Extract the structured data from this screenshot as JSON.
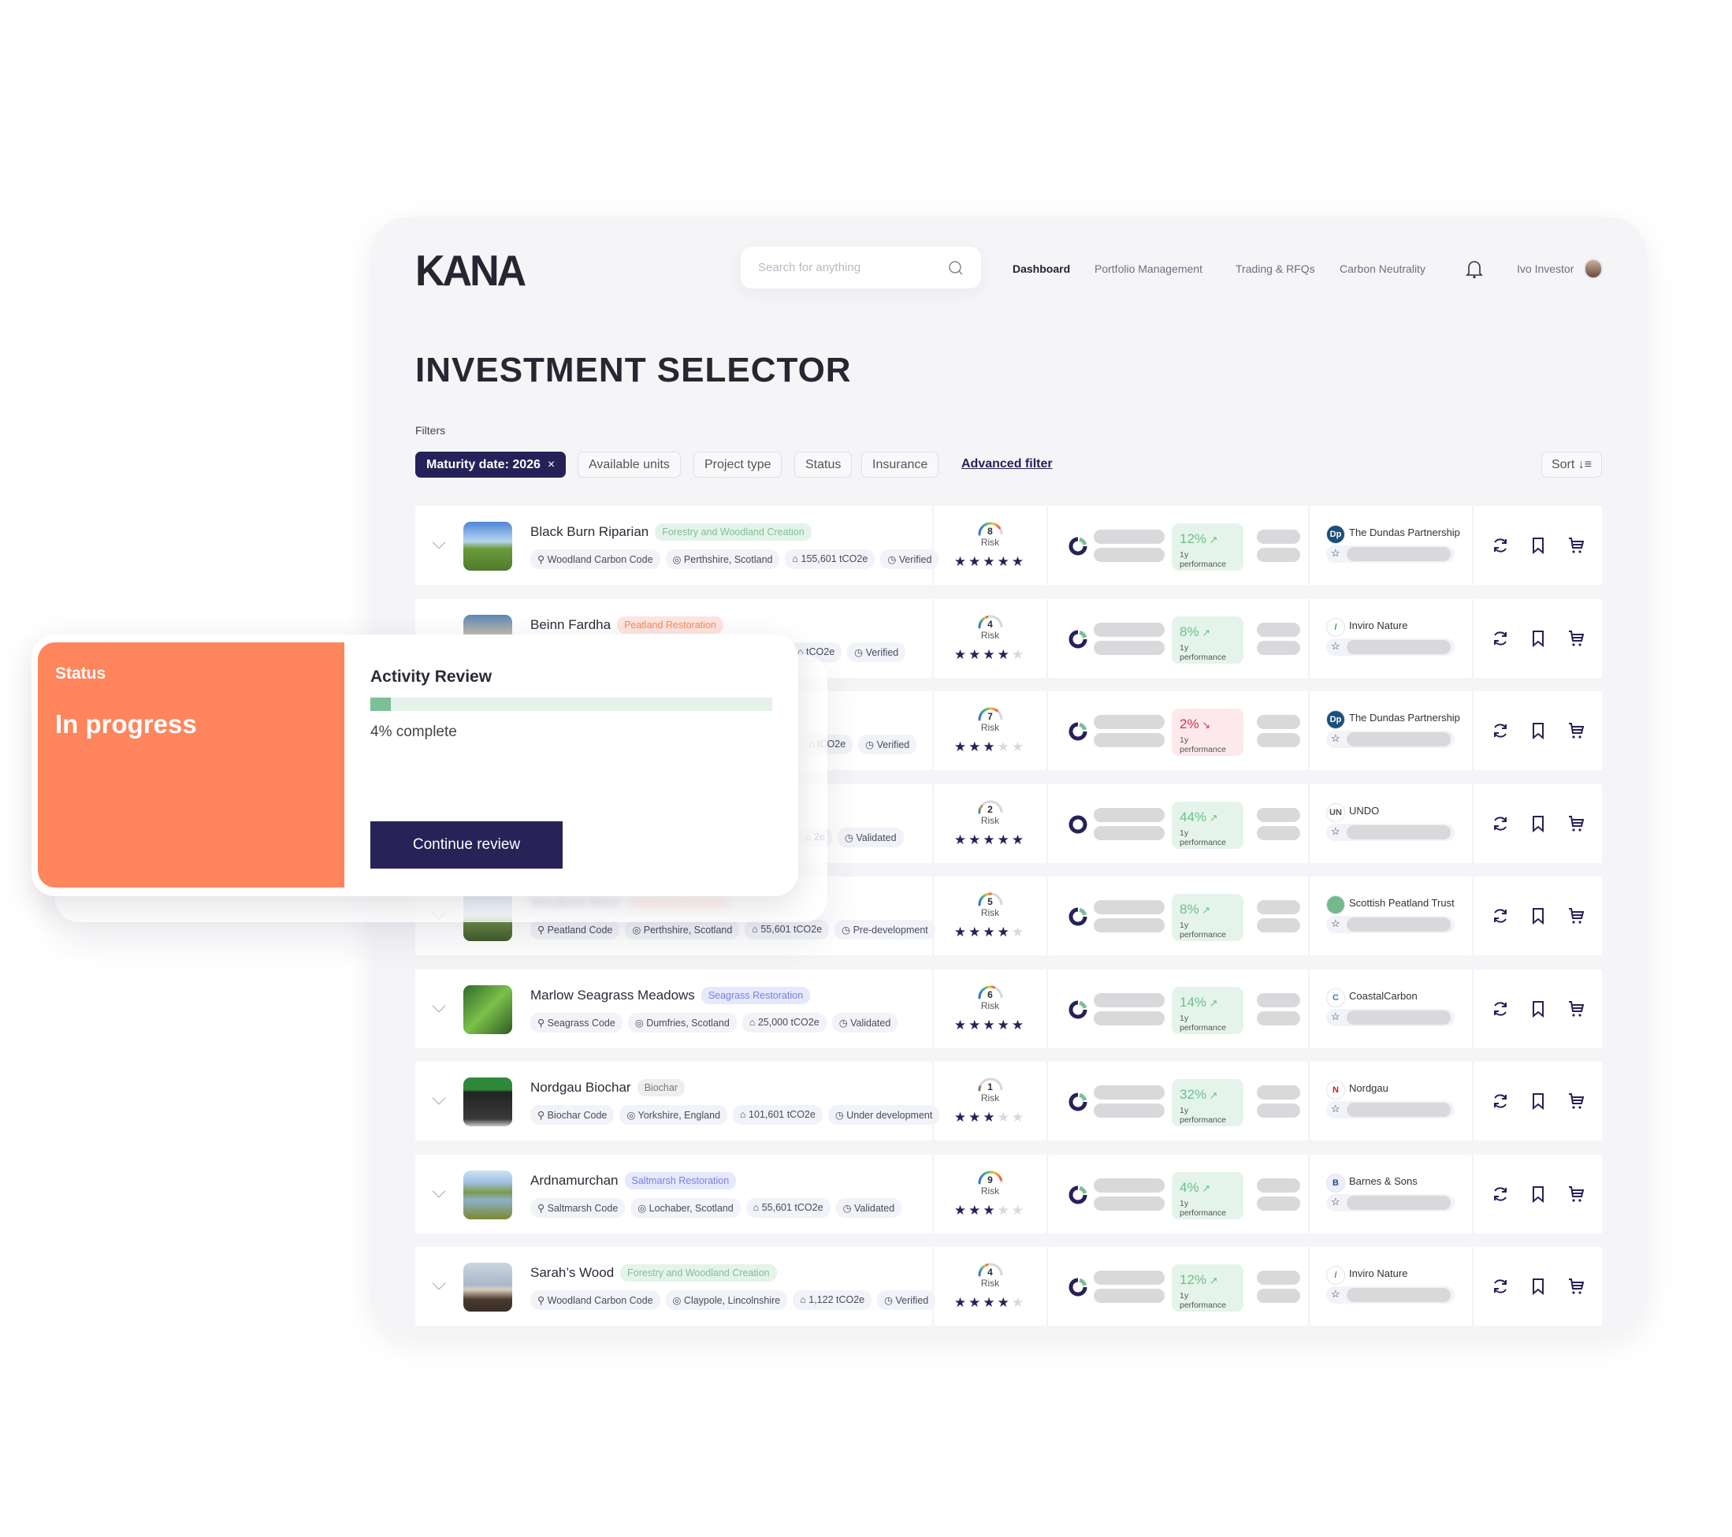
{
  "header": {
    "logo": "KANA",
    "search_placeholder": "Search for anything",
    "nav": [
      "Dashboard",
      "Portfolio Management",
      "Trading & RFQs",
      "Carbon Neutrality"
    ],
    "user": "Ivo Investor"
  },
  "page": {
    "title": "INVESTMENT SELECTOR",
    "filters_label": "Filters",
    "filters": [
      "Maturity date: 2026",
      "Available units",
      "Project type",
      "Status",
      "Insurance"
    ],
    "active_filter_clear": "×",
    "advanced_filter": "Advanced filter",
    "sort": "Sort ↓≡"
  },
  "colors": {
    "accent": "#262158",
    "orange": "#ff855c",
    "green": "#7cc097",
    "positive_bg": "#e5f4ea",
    "negative_bg": "#fde9ec",
    "positive_text": "#6cbf8c",
    "negative_text": "#d9304a"
  },
  "perf_label": "1y performance",
  "risk_label": "Risk",
  "rows": [
    {
      "name": "Black Burn Riparian",
      "category": "Forestry and Woodland Creation",
      "cat_type": "forest",
      "chips": [
        "Woodland Carbon Code",
        "Perthshire, Scotland",
        "155,601 tCO2e",
        "Verified"
      ],
      "risk": 8,
      "stars": 5,
      "performance": "12%",
      "trend": "up",
      "partner": "The Dundas Partnership",
      "partner_logo": "dundas"
    },
    {
      "name": "Beinn Fardha",
      "category": "Peatland Restoration",
      "cat_type": "peat",
      "chips": [
        "tCO2e",
        "Verified"
      ],
      "risk": 4,
      "stars": 4,
      "performance": "8%",
      "trend": "up",
      "partner": "Inviro Nature",
      "partner_logo": "inviro"
    },
    {
      "name": "",
      "category": "",
      "cat_type": "",
      "chips": [
        "tCO2e",
        "Verified"
      ],
      "risk": 7,
      "stars": 3,
      "performance": "2%",
      "trend": "down",
      "partner": "The Dundas Partnership",
      "partner_logo": "dundas"
    },
    {
      "name": "",
      "category": "",
      "cat_type": "",
      "chips": [
        "2e",
        "Validated"
      ],
      "risk": 2,
      "stars": 5,
      "performance": "44%",
      "trend": "up",
      "partner": "UNDO",
      "partner_logo": "undo"
    },
    {
      "name": "Windlech Moor",
      "category": "Peatland Restoration",
      "cat_type": "peat",
      "chips": [
        "Peatland Code",
        "Perthshire, Scotland",
        "55,601 tCO2e",
        "Pre-development"
      ],
      "risk": 5,
      "stars": 4,
      "performance": "8%",
      "trend": "up",
      "partner": "Scottish Peatland Trust",
      "partner_logo": "spt"
    },
    {
      "name": "Marlow Seagrass Meadows",
      "category": "Seagrass Restoration",
      "cat_type": "sea",
      "chips": [
        "Seagrass Code",
        "Dumfries, Scotland",
        "25,000 tCO2e",
        "Validated"
      ],
      "risk": 6,
      "stars": 5,
      "performance": "14%",
      "trend": "up",
      "partner": "CoastalCarbon",
      "partner_logo": "coastal"
    },
    {
      "name": "Nordgau Biochar",
      "category": "Biochar",
      "cat_type": "biochar",
      "chips": [
        "Biochar Code",
        "Yorkshire, England",
        "101,601 tCO2e",
        "Under development"
      ],
      "risk": 1,
      "stars": 3,
      "performance": "32%",
      "trend": "up",
      "partner": "Nordgau",
      "partner_logo": "nordgau"
    },
    {
      "name": "Ardnamurchan",
      "category": "Saltmarsh Restoration",
      "cat_type": "sea",
      "chips": [
        "Saltmarsh Code",
        "Lochaber, Scotland",
        "55,601 tCO2e",
        "Validated"
      ],
      "risk": 9,
      "stars": 3,
      "performance": "4%",
      "trend": "up",
      "partner": "Barnes & Sons",
      "partner_logo": "barnes"
    },
    {
      "name": "Sarah’s Wood",
      "category": "Forestry and Woodland Creation",
      "cat_type": "forest",
      "chips": [
        "Woodland Carbon Code",
        "Claypole, Lincolnshire",
        "1,122 tCO2e",
        "Verified"
      ],
      "risk": 4,
      "stars": 4,
      "performance": "12%",
      "trend": "up",
      "partner": "Inviro Nature",
      "partner_logo": "inviro"
    }
  ],
  "overlay": {
    "status_label": "Status",
    "status_value": "In progress",
    "title": "Activity Review",
    "progress_percent": 4,
    "progress_text": "4% complete",
    "button": "Continue review"
  }
}
